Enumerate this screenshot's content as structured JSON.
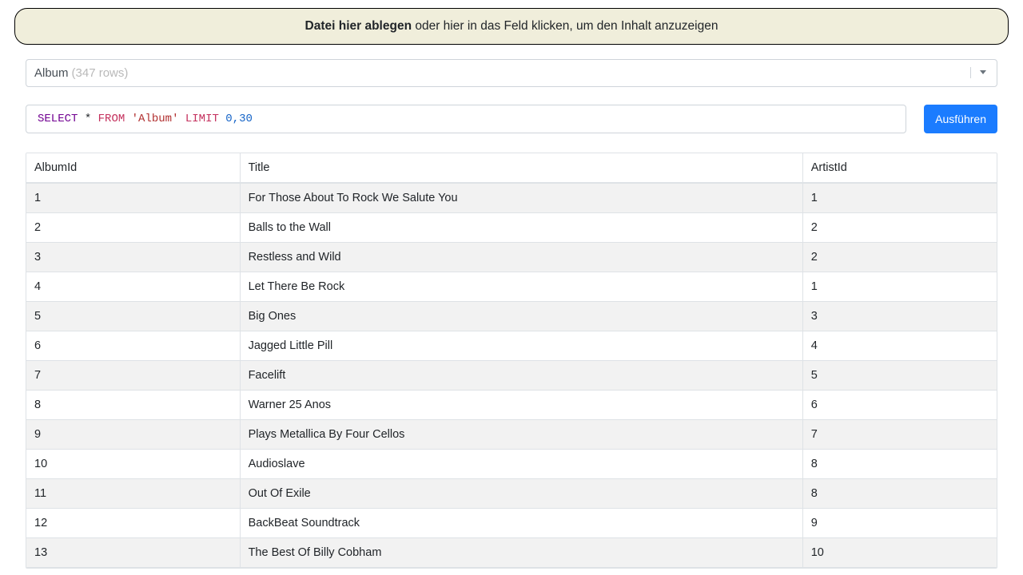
{
  "dropzone": {
    "strong_text": "Datei hier ablegen",
    "rest_text": " oder hier in das Feld klicken, um den Inhalt anzuzeigen"
  },
  "table_select": {
    "name": "Album",
    "rows_label": "(347 rows)"
  },
  "sql": {
    "select": "SELECT",
    "star": "*",
    "from": "FROM",
    "table_literal": "'Album'",
    "limit": "LIMIT",
    "limit_args": "0,30"
  },
  "run_button_label": "Ausführen",
  "columns": [
    "AlbumId",
    "Title",
    "ArtistId"
  ],
  "rows": [
    {
      "AlbumId": "1",
      "Title": "For Those About To Rock We Salute You",
      "ArtistId": "1"
    },
    {
      "AlbumId": "2",
      "Title": "Balls to the Wall",
      "ArtistId": "2"
    },
    {
      "AlbumId": "3",
      "Title": "Restless and Wild",
      "ArtistId": "2"
    },
    {
      "AlbumId": "4",
      "Title": "Let There Be Rock",
      "ArtistId": "1"
    },
    {
      "AlbumId": "5",
      "Title": "Big Ones",
      "ArtistId": "3"
    },
    {
      "AlbumId": "6",
      "Title": "Jagged Little Pill",
      "ArtistId": "4"
    },
    {
      "AlbumId": "7",
      "Title": "Facelift",
      "ArtistId": "5"
    },
    {
      "AlbumId": "8",
      "Title": "Warner 25 Anos",
      "ArtistId": "6"
    },
    {
      "AlbumId": "9",
      "Title": "Plays Metallica By Four Cellos",
      "ArtistId": "7"
    },
    {
      "AlbumId": "10",
      "Title": "Audioslave",
      "ArtistId": "8"
    },
    {
      "AlbumId": "11",
      "Title": "Out Of Exile",
      "ArtistId": "8"
    },
    {
      "AlbumId": "12",
      "Title": "BackBeat Soundtrack",
      "ArtistId": "9"
    },
    {
      "AlbumId": "13",
      "Title": "The Best Of Billy Cobham",
      "ArtistId": "10"
    }
  ]
}
